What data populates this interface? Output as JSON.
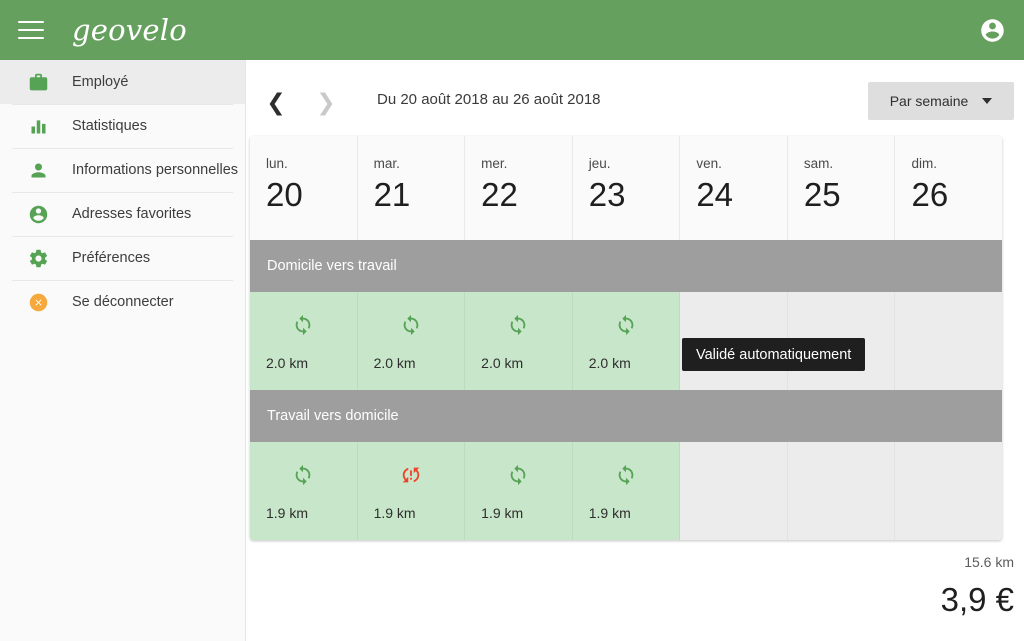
{
  "header": {
    "brand": "geovelo",
    "menu_icon": "hamburger-menu-icon",
    "account_icon": "account-circle-icon"
  },
  "sidebar": {
    "items": [
      {
        "label": "Employé",
        "icon": "briefcase-icon",
        "active": true
      },
      {
        "label": "Statistiques",
        "icon": "bar-chart-icon",
        "active": false
      },
      {
        "label": "Informations personnelles",
        "icon": "person-icon",
        "active": false
      },
      {
        "label": "Adresses favorites",
        "icon": "account-circle-icon",
        "active": false
      },
      {
        "label": "Préférences",
        "icon": "gear-icon",
        "active": false
      },
      {
        "label": "Se déconnecter",
        "icon": "close-circle-icon",
        "active": false
      }
    ]
  },
  "toolbar": {
    "prev_icon": "chevron-left-icon",
    "next_icon": "chevron-right-icon",
    "range_label": "Du 20 août 2018 au 26 août 2018",
    "period_label": "Par semaine",
    "period_caret_icon": "chevron-down-icon"
  },
  "calendar": {
    "days": [
      {
        "dow": "lun.",
        "num": "20"
      },
      {
        "dow": "mar.",
        "num": "21"
      },
      {
        "dow": "mer.",
        "num": "22"
      },
      {
        "dow": "jeu.",
        "num": "23"
      },
      {
        "dow": "ven.",
        "num": "24"
      },
      {
        "dow": "sam.",
        "num": "25"
      },
      {
        "dow": "dim.",
        "num": "26"
      }
    ],
    "rows": [
      {
        "band_label": "Domicile vers travail",
        "cells": [
          {
            "km": "2.0 km",
            "status": "synced",
            "icon": "sync-icon"
          },
          {
            "km": "2.0 km",
            "status": "synced",
            "icon": "sync-icon"
          },
          {
            "km": "2.0 km",
            "status": "synced",
            "icon": "sync-icon"
          },
          {
            "km": "2.0 km",
            "status": "synced",
            "icon": "sync-icon"
          },
          {
            "km": "",
            "status": "empty",
            "icon": ""
          },
          {
            "km": "",
            "status": "empty",
            "icon": ""
          },
          {
            "km": "",
            "status": "empty",
            "icon": ""
          }
        ]
      },
      {
        "band_label": "Travail vers domicile",
        "cells": [
          {
            "km": "1.9 km",
            "status": "synced",
            "icon": "sync-icon"
          },
          {
            "km": "1.9 km",
            "status": "problem",
            "icon": "sync-problem-icon"
          },
          {
            "km": "1.9 km",
            "status": "synced",
            "icon": "sync-icon"
          },
          {
            "km": "1.9 km",
            "status": "synced",
            "icon": "sync-icon"
          },
          {
            "km": "",
            "status": "empty",
            "icon": ""
          },
          {
            "km": "",
            "status": "empty",
            "icon": ""
          },
          {
            "km": "",
            "status": "empty",
            "icon": ""
          }
        ]
      }
    ]
  },
  "tooltip": {
    "text": "Validé automatiquement"
  },
  "totals": {
    "distance": "15.6 km",
    "amount": "3,9 €"
  },
  "colors": {
    "brand_green": "#66a05e",
    "cell_green": "#c8e6c9",
    "icon_green": "#56a355",
    "band_gray": "#9e9e9e",
    "empty_gray": "#ececec",
    "logout_orange": "#f5a83c",
    "problem_red": "#f0422a"
  }
}
